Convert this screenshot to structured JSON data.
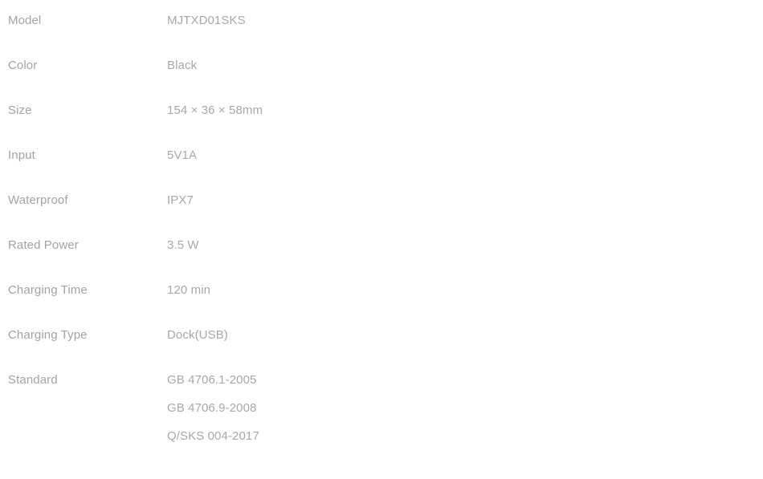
{
  "document": {
    "type": "product-specification-table",
    "background_color": "#ffffff",
    "label_color": "#a3a3a3",
    "value_color": "#a8a8a8"
  },
  "specs": [
    {
      "label": "Model",
      "value": "MJTXD01SKS"
    },
    {
      "label": "Color",
      "value": "Black"
    },
    {
      "label": "Size",
      "value": "154 × 36 × 58mm"
    },
    {
      "label": "Input",
      "value": "5V1A"
    },
    {
      "label": "Waterproof",
      "value": "IPX7"
    },
    {
      "label": "Rated Power",
      "value": "3.5 W"
    },
    {
      "label": "Charging Time",
      "value": "120 min"
    },
    {
      "label": "Charging Type",
      "value": "Dock(USB)"
    }
  ],
  "standard": {
    "label": "Standard",
    "values": [
      "GB 4706.1-2005",
      "GB 4706.9-2008",
      "Q/SKS 004-2017"
    ]
  }
}
